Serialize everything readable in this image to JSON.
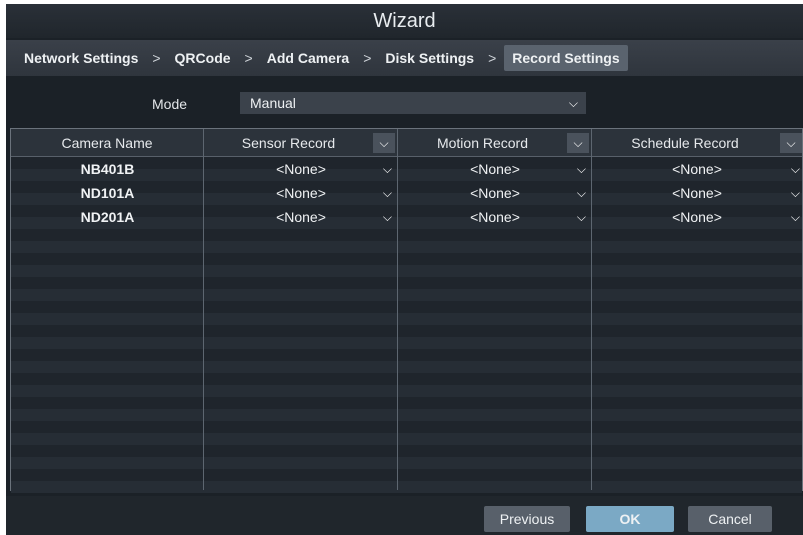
{
  "window": {
    "title": "Wizard"
  },
  "breadcrumb": {
    "items": [
      {
        "label": "Network Settings"
      },
      {
        "label": "QRCode"
      },
      {
        "label": "Add Camera"
      },
      {
        "label": "Disk Settings"
      },
      {
        "label": "Record Settings",
        "active": true
      }
    ],
    "separator": ">"
  },
  "mode": {
    "label": "Mode",
    "value": "Manual"
  },
  "table": {
    "columns": [
      "Camera Name",
      "Sensor Record",
      "Motion Record",
      "Schedule Record"
    ],
    "rows": [
      {
        "camera": "NB401B",
        "sensor": "<None>",
        "motion": "<None>",
        "schedule": "<None>"
      },
      {
        "camera": "ND101A",
        "sensor": "<None>",
        "motion": "<None>",
        "schedule": "<None>"
      },
      {
        "camera": "ND201A",
        "sensor": "<None>",
        "motion": "<None>",
        "schedule": "<None>"
      }
    ]
  },
  "footer": {
    "previous_label": "Previous",
    "ok_label": "OK",
    "cancel_label": "Cancel"
  },
  "icons": {
    "dropdown": "chevron-down-icon"
  },
  "colors": {
    "accent": "#7ba9c5",
    "background": "#1b2127"
  }
}
